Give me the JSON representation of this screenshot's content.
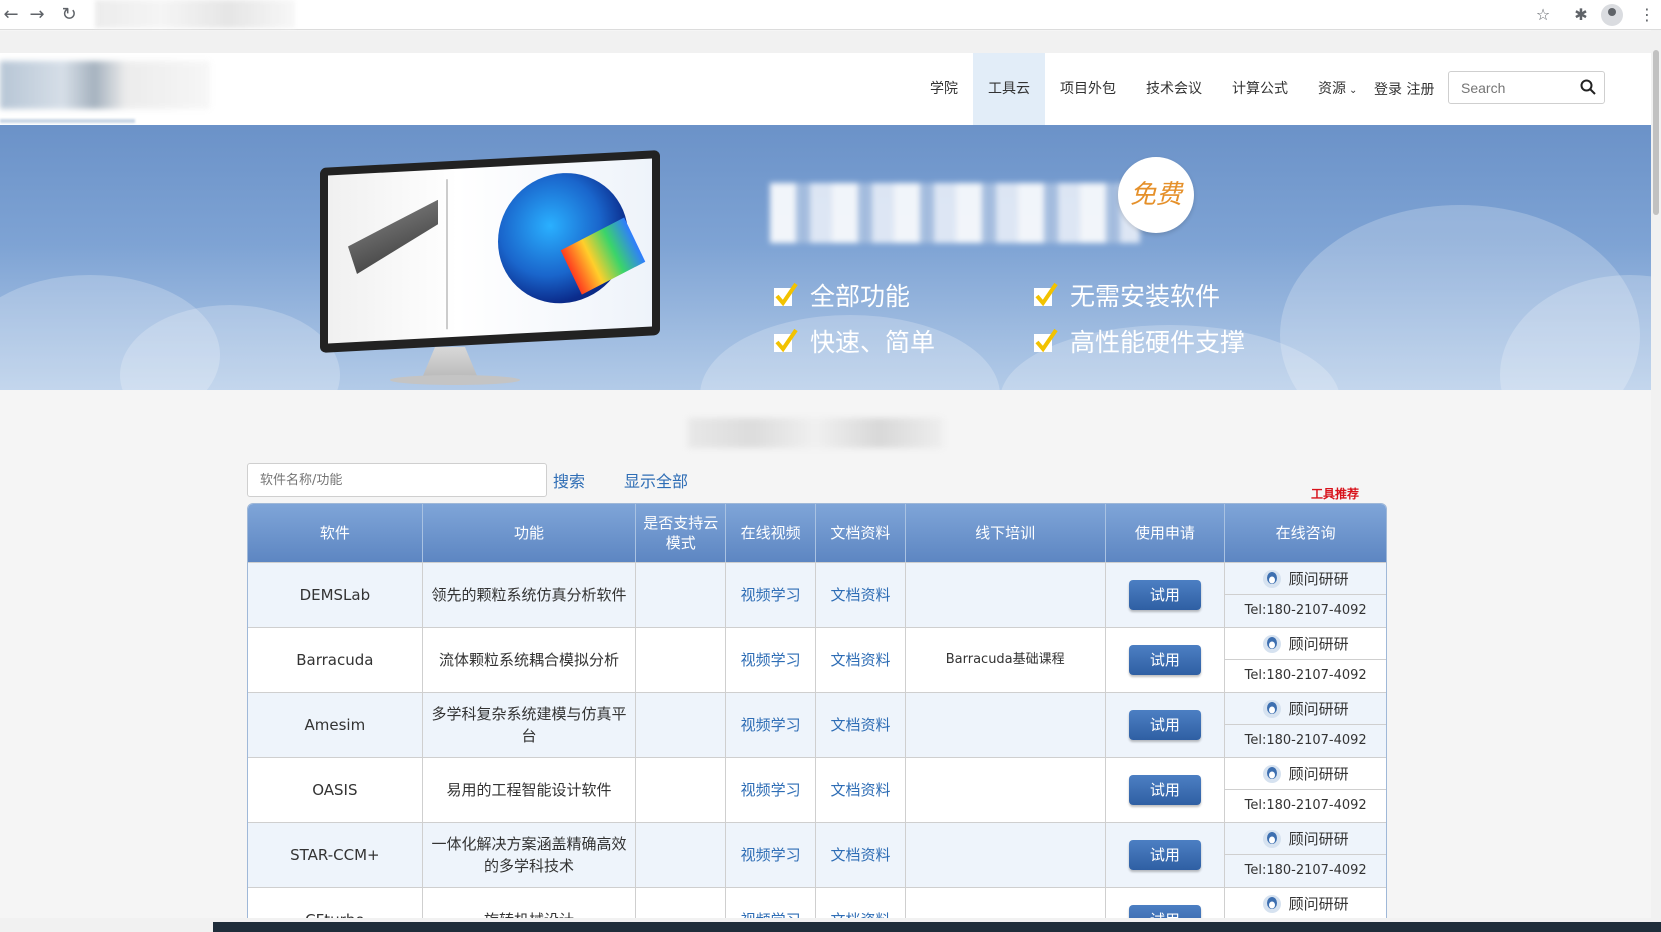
{
  "browser": {
    "icons": [
      "back-arrow-icon",
      "forward-arrow-icon",
      "reload-icon",
      "star-icon",
      "extensions-icon",
      "profile-icon",
      "menu-icon"
    ]
  },
  "header": {
    "nav": [
      {
        "label": "学院"
      },
      {
        "label": "工具云",
        "active": true
      },
      {
        "label": "项目外包"
      },
      {
        "label": "技术会议"
      },
      {
        "label": "计算公式"
      },
      {
        "label": "资源"
      }
    ],
    "login_label": "登录 注册",
    "search_placeholder": "Search"
  },
  "banner": {
    "free_badge": "免费",
    "features": [
      "全部功能",
      "无需安装软件",
      "快速、简单",
      "高性能硬件支撑"
    ]
  },
  "tools": {
    "search_placeholder": "软件名称/功能",
    "search_label": "搜索",
    "show_all_label": "显示全部",
    "recommend_label": "工具推荐",
    "columns": [
      "软件",
      "功能",
      "是否支持云模式",
      "在线视频",
      "文档资料",
      "线下培训",
      "使用申请",
      "在线咨询"
    ],
    "rows": [
      {
        "software": "DEMSLab",
        "function": "领先的颗粒系统仿真分析软件",
        "cloud": "",
        "video": "视频学习",
        "docs": "文档资料",
        "training": "",
        "apply": "试用",
        "consultant": "顾问研研",
        "tel": "Tel:180-2107-4092"
      },
      {
        "software": "Barracuda",
        "function": "流体颗粒系统耦合模拟分析",
        "cloud": "",
        "video": "视频学习",
        "docs": "文档资料",
        "training": "Barracuda基础课程",
        "apply": "试用",
        "consultant": "顾问研研",
        "tel": "Tel:180-2107-4092"
      },
      {
        "software": "Amesim",
        "function": "多学科复杂系统建模与仿真平台",
        "cloud": "",
        "video": "视频学习",
        "docs": "文档资料",
        "training": "",
        "apply": "试用",
        "consultant": "顾问研研",
        "tel": "Tel:180-2107-4092"
      },
      {
        "software": "OASIS",
        "function": "易用的工程智能设计软件",
        "cloud": "",
        "video": "视频学习",
        "docs": "文档资料",
        "training": "",
        "apply": "试用",
        "consultant": "顾问研研",
        "tel": "Tel:180-2107-4092"
      },
      {
        "software": "STAR-CCM+",
        "function": "一体化解决方案涵盖精确高效的多学科技术",
        "cloud": "",
        "video": "视频学习",
        "docs": "文档资料",
        "training": "",
        "apply": "试用",
        "consultant": "顾问研研",
        "tel": "Tel:180-2107-4092"
      },
      {
        "software": "CFturbo",
        "function": "旋转机械设计",
        "cloud": "",
        "video": "视频学习",
        "docs": "文档资料",
        "training": "",
        "apply": "试用",
        "consultant": "顾问研研",
        "tel": ""
      }
    ]
  },
  "colors": {
    "link": "#2e6db5",
    "header_row": "#6f97cf",
    "active_nav_bg": "#e2edf8",
    "recommend": "#d8121b",
    "button": "#3a6cb2"
  }
}
